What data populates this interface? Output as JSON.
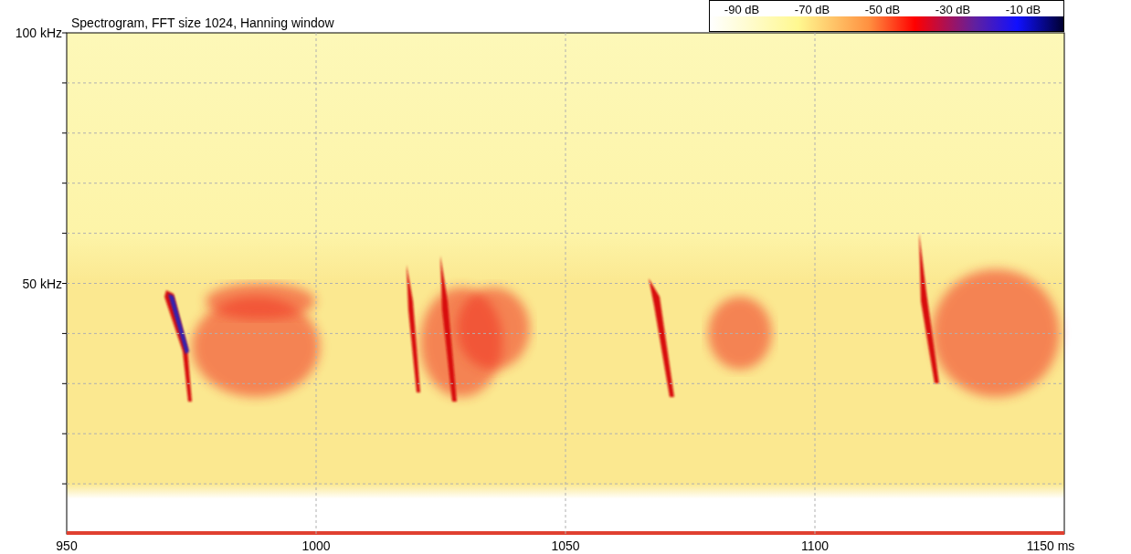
{
  "title": "Spectrogram, FFT size 1024, Hanning window",
  "colorbar": {
    "labels": [
      "-90 dB",
      "-70 dB",
      "-50 dB",
      "-30 dB",
      "-10 dB"
    ]
  },
  "y_axis": {
    "labels": [
      "100 kHz",
      "50 kHz"
    ]
  },
  "x_axis": {
    "labels": [
      "950",
      "1000",
      "1050",
      "1100",
      "1150 ms"
    ]
  }
}
